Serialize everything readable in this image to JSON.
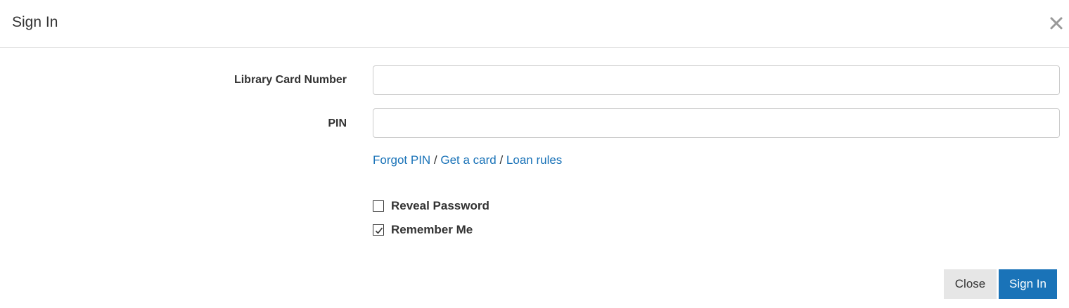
{
  "header": {
    "title": "Sign In",
    "close_icon": "close-icon"
  },
  "form": {
    "card_label": "Library Card Number",
    "card_value": "",
    "pin_label": "PIN",
    "pin_value": ""
  },
  "links": {
    "forgot_pin": "Forgot PIN",
    "separator_1": " / ",
    "get_card": "Get a card",
    "separator_2": " / ",
    "loan_rules": "Loan rules"
  },
  "options": {
    "reveal_password": {
      "label": "Reveal Password",
      "checked": false
    },
    "remember_me": {
      "label": "Remember Me",
      "checked": true
    }
  },
  "footer": {
    "close_label": "Close",
    "signin_label": "Sign In"
  },
  "colors": {
    "accent": "#1a73b8",
    "secondary_button": "#e6e6e6",
    "text": "#333333",
    "border": "#cccccc"
  }
}
